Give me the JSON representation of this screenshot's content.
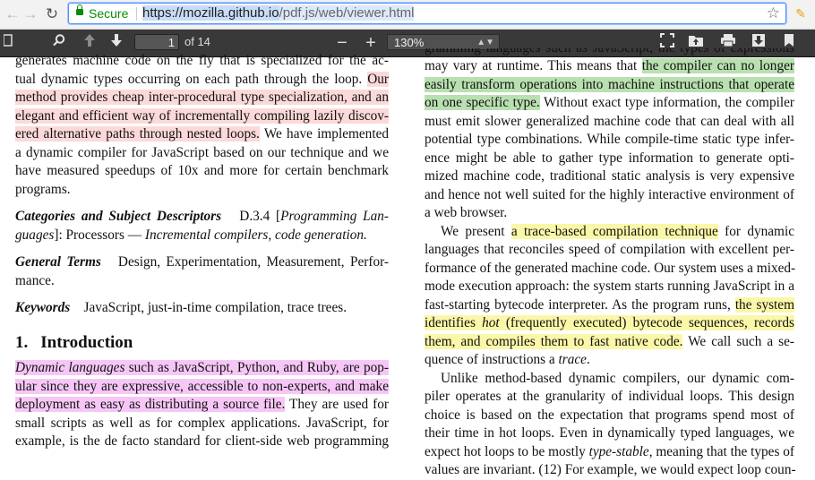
{
  "browser": {
    "secure_label": "Secure",
    "url_host": "https://mozilla.github.io",
    "url_path": "/pdf.js/web/viewer.html"
  },
  "toolbar": {
    "page_number": "1",
    "page_count": "of 14",
    "zoom_value": "130%",
    "zoom_out": "−",
    "zoom_in": "+"
  },
  "left_column": {
    "abstract_lines": [
      "generates machine code on the fly that is specialized for the ac-",
      "tual dynamic types occurring on each path through the loop.",
      "Our",
      "method provides cheap inter-procedural type specialization, and an",
      "elegant and efficient way of incrementally compiling lazily discov-",
      "ered alternative paths through nested loops.",
      " We have implemented",
      "a dynamic compiler for JavaScript based on our technique and we",
      "have measured speedups of 10x and more for certain benchmark",
      "programs."
    ],
    "categories_label": "Categories and Subject Descriptors",
    "categories_text": "D.3.4 [",
    "categories_ital1": "Programming Lan-",
    "categories_ital2": "guages",
    "categories_text2": "]: Processors — ",
    "categories_ital3": "Incremental compilers, code generation.",
    "terms_label": "General Terms",
    "terms_text1": "Design, Experimentation, Measurement, Perfor-",
    "terms_text2": "mance.",
    "keywords_label": "Keywords",
    "keywords_text": "JavaScript, just-in-time compilation, trace trees.",
    "section_number": "1.",
    "section_title": "Introduction",
    "intro_lines": [
      "Dynamic languages",
      " such as JavaScript, Python, and Ruby, are pop-",
      "ular since they are expressive, accessible to non-experts, and make",
      "deployment as easy as distributing a source file.",
      " They are used for",
      "small scripts as well as for complex applications. JavaScript, for",
      "example, is the de facto standard for client-side web programming"
    ]
  },
  "right_column": {
    "top_cut_line": "gramming languages such as JavaScript, the types of expressions",
    "lines": [
      "may vary at runtime. This means that ",
      "the compiler can no longer",
      "easily transform operations into machine instructions that operate",
      "on one specific type.",
      " Without exact type information, the compiler",
      "must emit slower generalized machine code that can deal with all",
      "potential type combinations. While compile-time static type infer-",
      "ence might be able to gather type information to generate opti-",
      "mized machine code, traditional static analysis is very expensive",
      "and hence not well suited for the highly interactive environment of",
      "a web browser."
    ],
    "p2_start": "We present ",
    "p2_hl1": "a trace-based compilation technique",
    "p2_after": " for dynamic",
    "p2_lines": [
      "languages that reconciles speed of compilation with excellent per-",
      "formance of the generated machine code. Our system uses a mixed-",
      "mode execution approach: the system starts running JavaScript in a",
      "fast-starting bytecode interpreter. As the program runs, "
    ],
    "p2_hl2a": "the system",
    "p2_hl2b_pre": "identifies ",
    "p2_hl2b_ital": "hot",
    "p2_hl2b_post": " (frequently executed) bytecode sequences, records",
    "p2_hl2c": "them, and compiles them to fast native code.",
    "p2_after2": " We call such a se-",
    "p2_last_pre": "quence of instructions a ",
    "p2_last_ital": "trace",
    "p2_last_post": ".",
    "p3_lines": [
      "Unlike method-based dynamic compilers, our dynamic com-",
      "piler operates at the granularity of individual loops. This design",
      "choice is based on the expectation that programs spend most of",
      "their time in hot loops. Even in dynamically typed languages, we"
    ],
    "p3_l5_pre": "expect hot loops to be mostly ",
    "p3_l5_ital": "type-stable",
    "p3_l5_post": ", meaning that the types of",
    "p3_bottom_cut": "values are invariant. (12) For example, we would expect loop coun-"
  }
}
